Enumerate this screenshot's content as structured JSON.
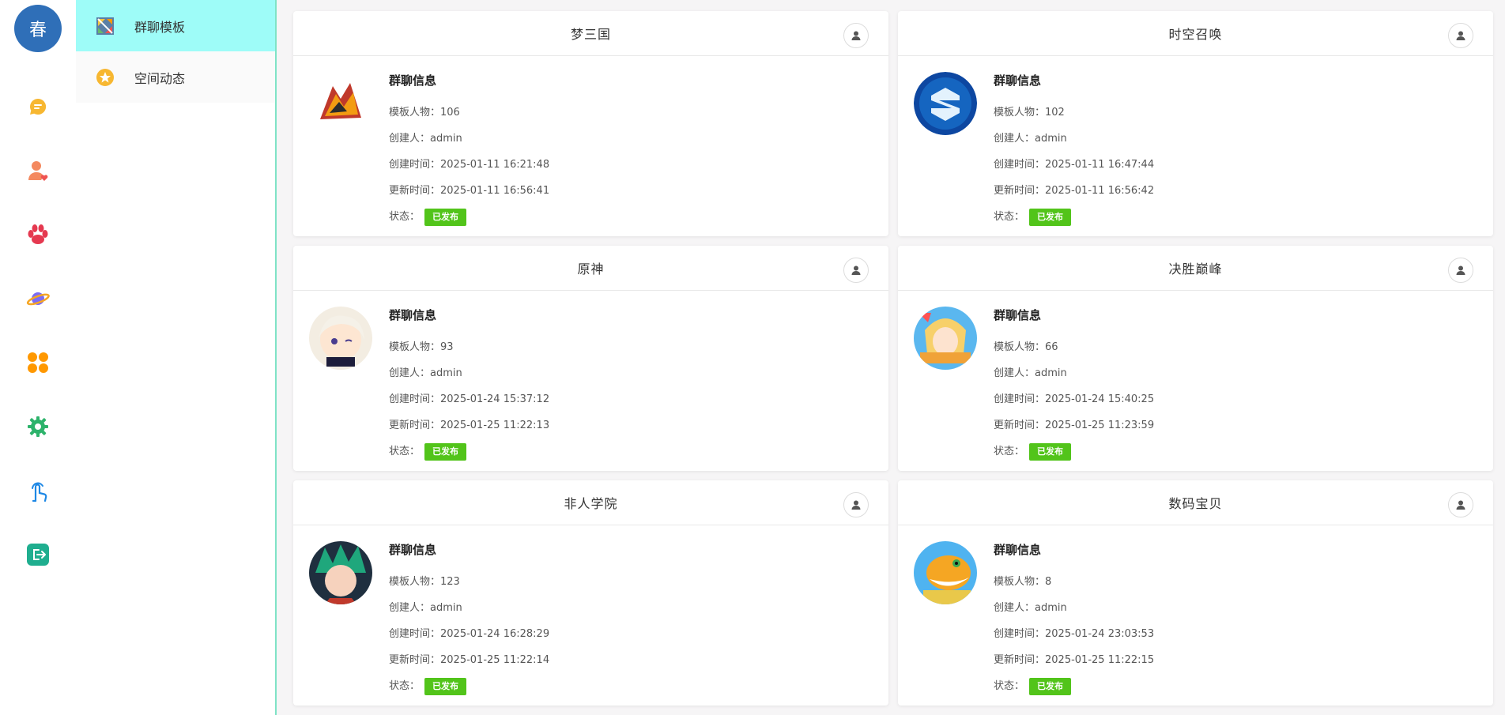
{
  "user": {
    "avatar_text": "春"
  },
  "rail_icons": [
    "chat-icon",
    "user-heart-icon",
    "paw-icon",
    "planet-icon",
    "apps-icon",
    "settings-icon",
    "touch-icon",
    "logout-icon"
  ],
  "submenu": {
    "items": [
      {
        "label": "群聊模板",
        "icon": "template-icon",
        "active": true
      },
      {
        "label": "空间动态",
        "icon": "star-icon",
        "active": false
      }
    ]
  },
  "labels": {
    "info_title": "群聊信息",
    "count": "模板人物：",
    "creator": "创建人：",
    "created": "创建时间：",
    "updated": "更新时间：",
    "status": "状态："
  },
  "cards": [
    {
      "title": "梦三国",
      "count": "106",
      "creator": "admin",
      "created": "2025-01-11 16:21:48",
      "updated": "2025-01-11 16:56:41",
      "status": "已发布",
      "image": "game-logo-menghanguo"
    },
    {
      "title": "时空召唤",
      "count": "102",
      "creator": "admin",
      "created": "2025-01-11 16:47:44",
      "updated": "2025-01-11 16:56:42",
      "status": "已发布",
      "image": "game-logo-shikong"
    },
    {
      "title": "原神",
      "count": "93",
      "creator": "admin",
      "created": "2025-01-24 15:37:12",
      "updated": "2025-01-25 11:22:13",
      "status": "已发布",
      "image": "game-logo-yuanshen"
    },
    {
      "title": "决胜巅峰",
      "count": "66",
      "creator": "admin",
      "created": "2025-01-24 15:40:25",
      "updated": "2025-01-25 11:23:59",
      "status": "已发布",
      "image": "game-logo-juesheng"
    },
    {
      "title": "非人学院",
      "count": "123",
      "creator": "admin",
      "created": "2025-01-24 16:28:29",
      "updated": "2025-01-25 11:22:14",
      "status": "已发布",
      "image": "game-logo-feiren"
    },
    {
      "title": "数码宝贝",
      "count": "8",
      "creator": "admin",
      "created": "2025-01-24 23:03:53",
      "updated": "2025-01-25 11:22:15",
      "status": "已发布",
      "image": "game-logo-digimon"
    }
  ],
  "colors": {
    "accent": "#9efcf8",
    "status_green": "#52c41a",
    "avatar_blue": "#2f6fb8",
    "divider": "#7fe3c6"
  }
}
